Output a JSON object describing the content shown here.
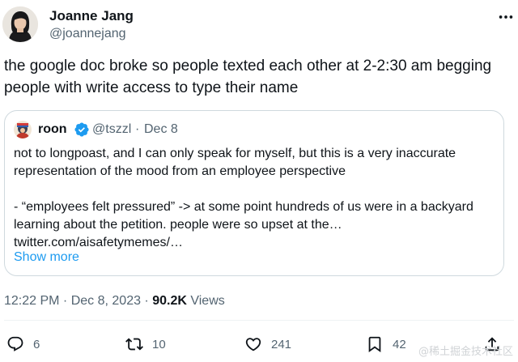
{
  "author": {
    "name": "Joanne Jang",
    "handle": "@joannejang"
  },
  "tweet": {
    "text": "the google doc broke so people texted each other at 2-2:30 am begging people with write access to type their name"
  },
  "quoted": {
    "name": "roon",
    "handle": "@tszzl",
    "separator": "·",
    "date": "Dec 8",
    "paragraph1": "not to longpoast, and I can only speak for myself, but this is a very inaccurate representation of the mood from an employee perspective",
    "paragraph2": "- “employees felt pressured” -> at some point hundreds of us were in a backyard learning about the petition. people were so upset at the…",
    "link": "twitter.com/aisafetymemes/…",
    "show_more": "Show more"
  },
  "meta": {
    "time": "12:22 PM · Dec 8, 2023 · ",
    "views_count": "90.2K",
    "views_label": " Views"
  },
  "actions": {
    "replies": "6",
    "retweets": "10",
    "likes": "241",
    "bookmarks": "42"
  },
  "watermark": "@稀土掘金技术社区",
  "colors": {
    "text": "#0f1419",
    "secondary": "#536471",
    "link": "#1d9bf0",
    "border": "#cfd9de"
  },
  "icons": {
    "more": "more-dots-icon",
    "verified": "verified-badge-icon",
    "reply": "reply-icon",
    "retweet": "retweet-icon",
    "like": "heart-icon",
    "bookmark": "bookmark-icon",
    "share": "share-icon"
  }
}
